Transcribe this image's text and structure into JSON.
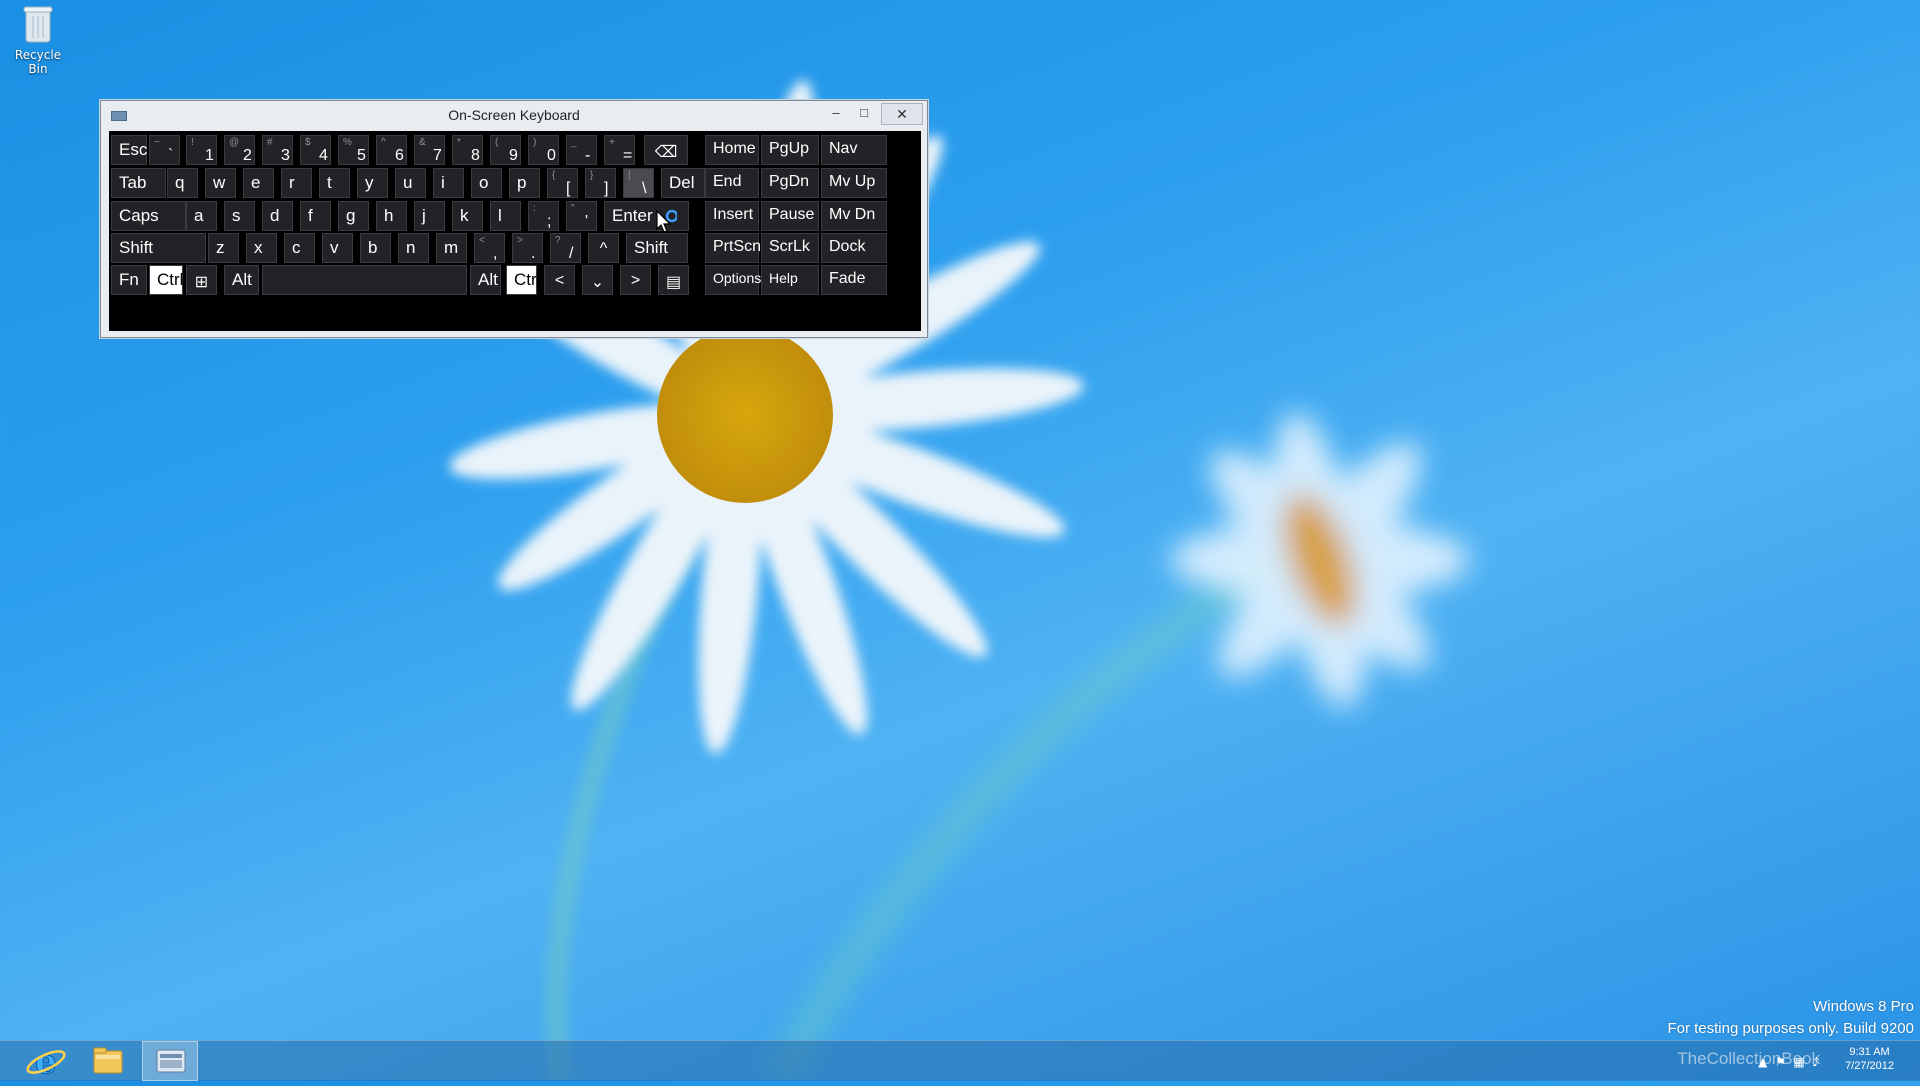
{
  "desktop": {
    "recycle_bin_label": "Recycle Bin"
  },
  "osk": {
    "title": "On-Screen Keyboard",
    "window_controls": {
      "minimize": "–",
      "maximize": "□",
      "close": "✕"
    },
    "rows": [
      [
        {
          "id": "esc",
          "label": "Esc"
        },
        {
          "id": "backtick",
          "shift": "~",
          "label": "`"
        },
        {
          "id": "1",
          "shift": "!",
          "label": "1"
        },
        {
          "id": "2",
          "shift": "@",
          "label": "2"
        },
        {
          "id": "3",
          "shift": "#",
          "label": "3"
        },
        {
          "id": "4",
          "shift": "$",
          "label": "4"
        },
        {
          "id": "5",
          "shift": "%",
          "label": "5"
        },
        {
          "id": "6",
          "shift": "^",
          "label": "6"
        },
        {
          "id": "7",
          "shift": "&",
          "label": "7"
        },
        {
          "id": "8",
          "shift": "*",
          "label": "8"
        },
        {
          "id": "9",
          "shift": "(",
          "label": "9"
        },
        {
          "id": "0",
          "shift": ")",
          "label": "0"
        },
        {
          "id": "minus",
          "shift": "_",
          "label": "-"
        },
        {
          "id": "equals",
          "shift": "+",
          "label": "="
        },
        {
          "id": "backspace",
          "label": "⌫"
        }
      ],
      [
        {
          "id": "tab",
          "label": "Tab"
        },
        {
          "id": "q",
          "label": "q"
        },
        {
          "id": "w",
          "label": "w"
        },
        {
          "id": "e",
          "label": "e"
        },
        {
          "id": "r",
          "label": "r"
        },
        {
          "id": "t",
          "label": "t"
        },
        {
          "id": "y",
          "label": "y"
        },
        {
          "id": "u",
          "label": "u"
        },
        {
          "id": "i",
          "label": "i"
        },
        {
          "id": "o",
          "label": "o"
        },
        {
          "id": "p",
          "label": "p"
        },
        {
          "id": "lbracket",
          "shift": "{",
          "label": "["
        },
        {
          "id": "rbracket",
          "shift": "}",
          "label": "]"
        },
        {
          "id": "backslash",
          "shift": "|",
          "label": "\\"
        },
        {
          "id": "del",
          "label": "Del"
        }
      ],
      [
        {
          "id": "caps",
          "label": "Caps"
        },
        {
          "id": "a",
          "label": "a"
        },
        {
          "id": "s",
          "label": "s"
        },
        {
          "id": "d",
          "label": "d"
        },
        {
          "id": "f",
          "label": "f"
        },
        {
          "id": "g",
          "label": "g"
        },
        {
          "id": "h",
          "label": "h"
        },
        {
          "id": "j",
          "label": "j"
        },
        {
          "id": "k",
          "label": "k"
        },
        {
          "id": "l",
          "label": "l"
        },
        {
          "id": "semicolon",
          "shift": ":",
          "label": ";"
        },
        {
          "id": "quote",
          "shift": "\"",
          "label": "'"
        },
        {
          "id": "enter",
          "label": "Enter"
        }
      ],
      [
        {
          "id": "lshift",
          "label": "Shift"
        },
        {
          "id": "z",
          "label": "z"
        },
        {
          "id": "x",
          "label": "x"
        },
        {
          "id": "c",
          "label": "c"
        },
        {
          "id": "v",
          "label": "v"
        },
        {
          "id": "b",
          "label": "b"
        },
        {
          "id": "n",
          "label": "n"
        },
        {
          "id": "m",
          "label": "m"
        },
        {
          "id": "comma",
          "shift": "<",
          "label": ","
        },
        {
          "id": "period",
          "shift": ">",
          "label": "."
        },
        {
          "id": "slash",
          "shift": "?",
          "label": "/"
        },
        {
          "id": "up",
          "label": "^"
        },
        {
          "id": "rshift",
          "label": "Shift"
        }
      ],
      [
        {
          "id": "fn",
          "label": "Fn"
        },
        {
          "id": "lctrl",
          "label": "Ctrl"
        },
        {
          "id": "win",
          "label": "⊞"
        },
        {
          "id": "lalt",
          "label": "Alt"
        },
        {
          "id": "space",
          "label": ""
        },
        {
          "id": "ralt",
          "label": "Alt"
        },
        {
          "id": "rctrl",
          "label": "Ctrl"
        },
        {
          "id": "left",
          "label": "<"
        },
        {
          "id": "down",
          "label": "⌄"
        },
        {
          "id": "right",
          "label": ">"
        },
        {
          "id": "menu",
          "label": "▤"
        }
      ]
    ],
    "nav_keys": [
      [
        "Home",
        "PgUp",
        "Nav"
      ],
      [
        "End",
        "PgDn",
        "Mv Up"
      ],
      [
        "Insert",
        "Pause",
        "Mv Dn"
      ],
      [
        "PrtScn",
        "ScrLk",
        "Dock"
      ],
      [
        "Options",
        "Help",
        "Fade"
      ]
    ]
  },
  "watermark": {
    "line1": "Windows 8 Pro",
    "line2": "For testing purposes only. Build 9200"
  },
  "tray": {
    "time": "9:31 AM",
    "date": "7/27/2012",
    "overlay_text": "TheCollectionBook"
  },
  "colors": {
    "desktop_blue": "#2d9fee",
    "key_bg": "#222326",
    "key_lit": "#ffffff"
  }
}
